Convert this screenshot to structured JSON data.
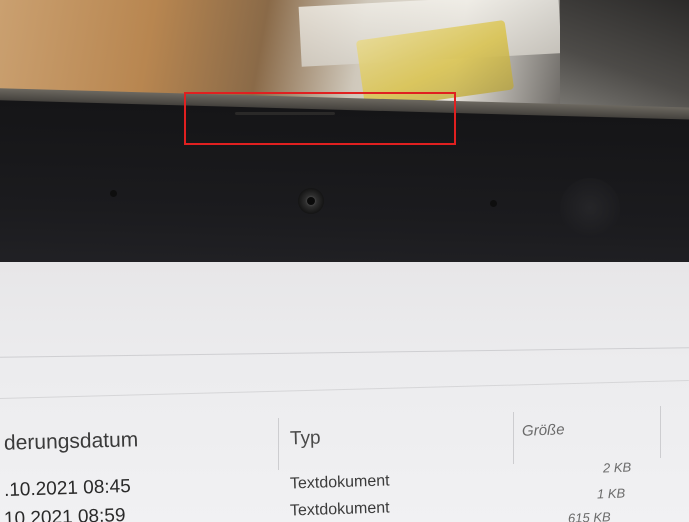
{
  "columns": {
    "date_header": "derungsdatum",
    "type_header": "Typ",
    "size_header": "Größe"
  },
  "rows": [
    {
      "date": ".10.2021 08:45",
      "type": "Textdokument",
      "size": "2 KB"
    },
    {
      "date": "10.2021 08:59",
      "type": "Textdokument",
      "size": "1 KB"
    },
    {
      "size": "615 KB"
    }
  ],
  "annotation": {
    "highlight_color": "#e02020"
  }
}
